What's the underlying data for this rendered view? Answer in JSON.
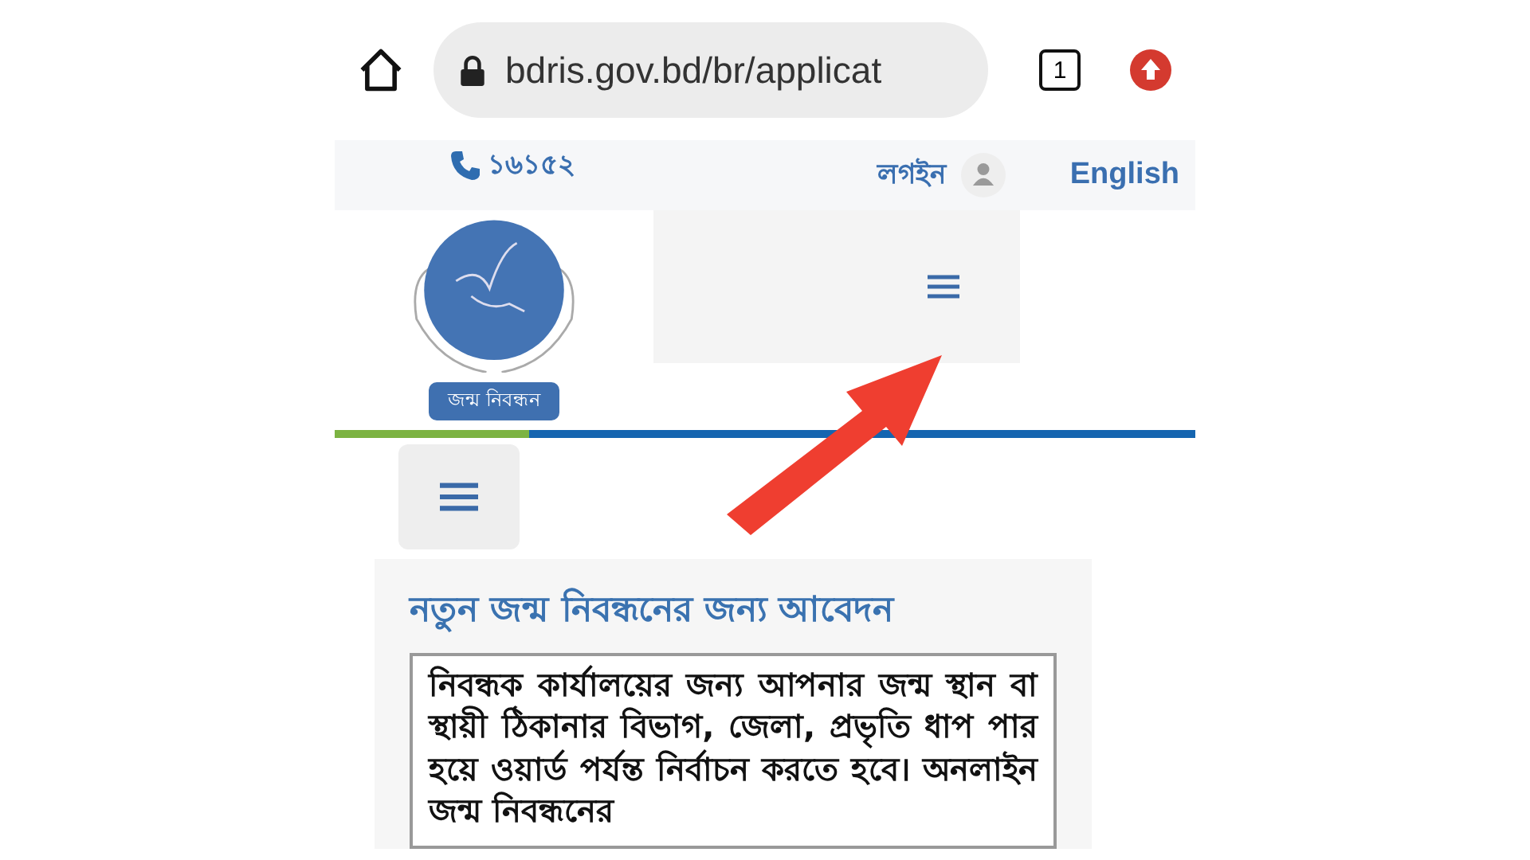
{
  "browser": {
    "url": "bdris.gov.bd/br/applicat",
    "tab_count": "1"
  },
  "topbar": {
    "phone": "১৬১৫২",
    "login": "লগইন",
    "language": "English"
  },
  "logo": {
    "caption": "জন্ম নিবন্ধন"
  },
  "card": {
    "title": "নতুন জন্ম নিবন্ধনের জন্য আবেদন",
    "body": "নিবন্ধক কার্যালয়ের জন্য আপনার জন্ম স্থান বা স্থায়ী ঠিকানার বিভাগ, জেলা, প্রভৃতি ধাপ পার হয়ে ওয়ার্ড পর্যন্ত নির্বাচন করতে হবে। অনলাইন জন্ম নিবন্ধনের"
  }
}
